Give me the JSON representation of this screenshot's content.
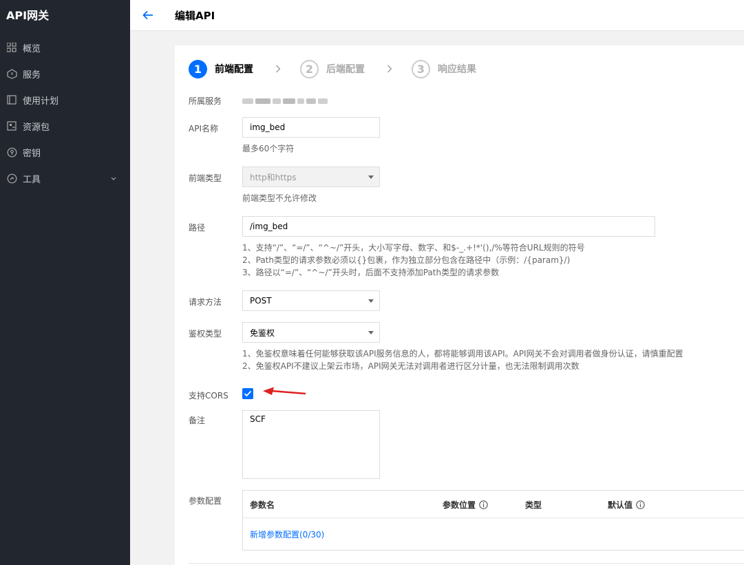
{
  "app": {
    "brand": "API网关"
  },
  "sidebar": {
    "items": [
      {
        "label": "概览",
        "icon": "grid-icon"
      },
      {
        "label": "服务",
        "icon": "service-icon"
      },
      {
        "label": "使用计划",
        "icon": "plan-icon"
      },
      {
        "label": "资源包",
        "icon": "package-icon"
      },
      {
        "label": "密钥",
        "icon": "key-icon"
      },
      {
        "label": "工具",
        "icon": "tool-icon"
      }
    ]
  },
  "header": {
    "title": "编辑API"
  },
  "steps": [
    {
      "num": "1",
      "label": "前端配置",
      "state": "active"
    },
    {
      "num": "2",
      "label": "后端配置",
      "state": "todo"
    },
    {
      "num": "3",
      "label": "响应结果",
      "state": "todo"
    }
  ],
  "form": {
    "service_label": "所属服务",
    "api_name_label": "API名称",
    "api_name_value": "img_bed",
    "api_name_hint": "最多60个字符",
    "frontend_type_label": "前端类型",
    "frontend_type_value": "http和https",
    "frontend_type_hint": "前端类型不允许修改",
    "path_label": "路径",
    "path_value": "/img_bed",
    "path_hints": [
      "1、支持“/”、“=/”、“^~/”开头，大小写字母、数字、和$-_.+!*'(),/%等符合URL规则的符号",
      "2、Path类型的请求参数必须以{}包裹，作为独立部分包含在路径中（示例：/{param}/)",
      "3、路径以“=/”、“^~/”开头时，后面不支持添加Path类型的请求参数"
    ],
    "method_label": "请求方法",
    "method_value": "POST",
    "auth_label": "鉴权类型",
    "auth_value": "免鉴权",
    "auth_hints": [
      "1、免鉴权意味着任何能够获取该API服务信息的人，都将能够调用该API。API网关不会对调用者做身份认证，请慎重配置",
      "2、免鉴权API不建议上架云市场，API网关无法对调用者进行区分计量，也无法限制调用次数"
    ],
    "cors_label": "支持CORS",
    "cors_checked": true,
    "remark_label": "备注",
    "remark_value": "SCF",
    "params_label": "参数配置"
  },
  "params_table": {
    "columns": [
      "参数名",
      "参数位置",
      "类型",
      "默认值"
    ],
    "add_link": "新增参数配置(0/30)"
  },
  "colors": {
    "accent": "#006eff",
    "sidebar_bg": "#22262e",
    "annotation_arrow": "#e02020"
  }
}
